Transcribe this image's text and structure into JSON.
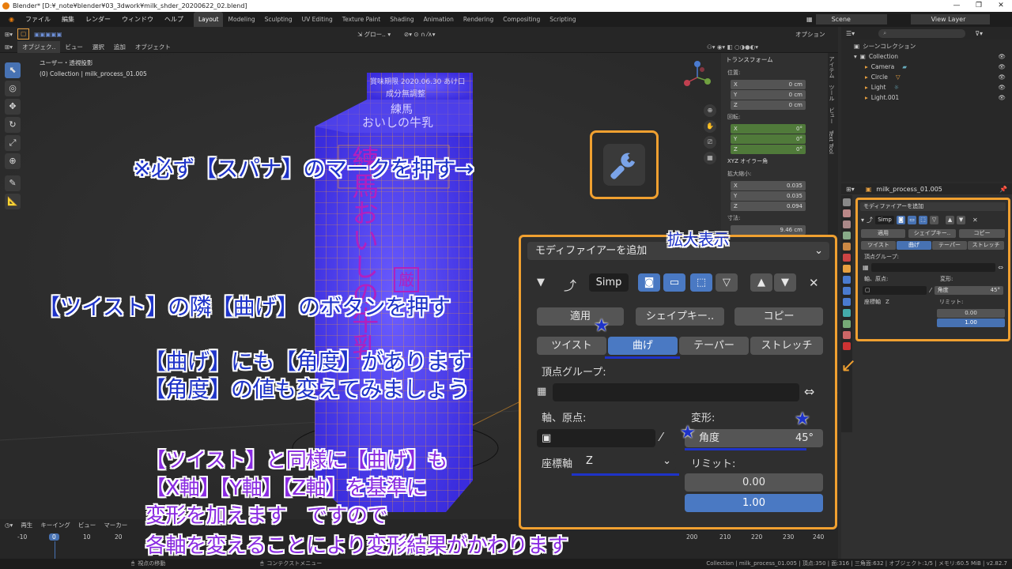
{
  "window": {
    "title": "Blender* [D:¥_note¥blender¥03_3dwork¥milk_shder_20200622_02.blend]",
    "controls": [
      "—",
      "❐",
      "✕"
    ]
  },
  "menus": [
    "ファイル",
    "編集",
    "レンダー",
    "ウィンドウ",
    "ヘルプ"
  ],
  "workspaces": [
    "Layout",
    "Modeling",
    "Sculpting",
    "UV Editing",
    "Texture Paint",
    "Shading",
    "Animation",
    "Rendering",
    "Compositing",
    "Scripting"
  ],
  "scene": {
    "label": "Scene",
    "view_layer": "View Layer"
  },
  "header": {
    "mode": "オブジェク..",
    "view": "ビュー",
    "select": "選択",
    "add": "追加",
    "object": "オブジェクト",
    "transform_orient": "グロー..",
    "options": "オプション"
  },
  "viewport": {
    "info_line1": "ユーザー・透視投影",
    "info_line2": "(0) Collection | milk_process_01.005"
  },
  "carton_text": {
    "top": "成分無調整",
    "brand": "練馬",
    "product": "おいしの牛乳",
    "date": "賞味期限 2020.06.30 あけ口",
    "vertical": "練馬おいしの牛乳",
    "stamp": "厳"
  },
  "npanel": {
    "section": "トランスフォーム",
    "location_label": "位置:",
    "location": [
      {
        "axis": "X",
        "value": "0 cm"
      },
      {
        "axis": "Y",
        "value": "0 cm"
      },
      {
        "axis": "Z",
        "value": "0 cm"
      }
    ],
    "rotation_label": "回転:",
    "rotation": [
      {
        "axis": "X",
        "value": "0°"
      },
      {
        "axis": "Y",
        "value": "0°"
      },
      {
        "axis": "Z",
        "value": "0°"
      }
    ],
    "rotation_mode": "XYZ オイラー角",
    "scale_label": "拡大縮小:",
    "scale": [
      {
        "axis": "X",
        "value": "0.035"
      },
      {
        "axis": "Y",
        "value": "0.035"
      },
      {
        "axis": "Z",
        "value": "0.094"
      }
    ],
    "dimensions_label": "寸法:",
    "dimensions_x": "9.46 cm",
    "tabs": [
      "アイテム",
      "ツール",
      "ビュー",
      "Text Tool"
    ]
  },
  "outliner": {
    "search_placeholder": "",
    "scene_collection": "シーンコレクション",
    "items": [
      {
        "name": "Collection",
        "level": 1,
        "color": "#ccc"
      },
      {
        "name": "Camera",
        "level": 2,
        "color": "#e8a040"
      },
      {
        "name": "Circle",
        "level": 2,
        "color": "#e8a040"
      },
      {
        "name": "Light",
        "level": 2,
        "color": "#e8a040"
      },
      {
        "name": "Light.001",
        "level": 2,
        "color": "#e8a040"
      }
    ]
  },
  "properties": {
    "object_name": "milk_process_01.005"
  },
  "small_modifier": {
    "add_modifier": "モディファイアーを追加",
    "name": "Simp",
    "apply": "適用",
    "shapekey": "シェイプキー..",
    "copy": "コピー",
    "modes": [
      "ツイスト",
      "曲げ",
      "テーパー",
      "ストレッチ"
    ],
    "active_mode": "曲げ",
    "vertex_group": "頂点グループ:",
    "axis_origin": "軸、原点:",
    "deform": "変形:",
    "angle_label": "角度",
    "angle_value": "45°",
    "coord_axis_label": "座標軸",
    "coord_axis_value": "Z",
    "limits": "リミット:",
    "limit_low": "0.00",
    "limit_high": "1.00"
  },
  "zoom_modifier": {
    "add_modifier": "モディファイアーを追加",
    "name": "Simp",
    "apply": "適用",
    "shapekey": "シェイプキー..",
    "copy": "コピー",
    "modes": [
      "ツイスト",
      "曲げ",
      "テーパー",
      "ストレッチ"
    ],
    "vertex_group": "頂点グループ:",
    "axis_origin": "軸、原点:",
    "deform": "変形:",
    "angle_label": "角度",
    "angle_value": "45°",
    "coord_axis_label": "座標軸",
    "coord_axis_value": "Z",
    "limits": "リミット:",
    "limit_low": "0.00",
    "limit_high": "1.00"
  },
  "annotations": {
    "wrench_note": "※必ず【スパナ】のマークを押す→",
    "zoom_label": "拡大表示",
    "bend_note": "【ツイスト】の隣【曲げ】のボタンを押す",
    "angle_note1": "【曲げ】にも【角度】があります",
    "angle_note2": "【角度】の値も変えてみましょう",
    "axis_note1": "【ツイスト】と同様に【曲げ】も",
    "axis_note2": "【X軸】【Y軸】【Z軸】を基準に",
    "axis_note3": "変形を加えます　ですので",
    "axis_note4": "各軸を変えることにより変形結果がかわります"
  },
  "timeline": {
    "playback": "再生",
    "keying": "キーイング",
    "view": "ビュー",
    "marker": "マーカー",
    "current_frame": "0",
    "ticks": [
      "-10",
      "0",
      "10",
      "20",
      "200",
      "210",
      "220",
      "230",
      "240"
    ]
  },
  "statusbar": {
    "left": "視点の移動",
    "middle": "コンテクストメニュー",
    "right": "Collection | milk_process_01.005 | 頂点:350 | 面:316 | 三角面:632 | オブジェクト:1/5 | メモリ:60.5 MiB | v2.82.7"
  },
  "colors": {
    "accent": "#4772b3",
    "highlight_box": "#f0a030",
    "annotation_blue": "#1e33c8",
    "annotation_purple": "#8a2be2",
    "carton_glow": "#4a3cff"
  }
}
